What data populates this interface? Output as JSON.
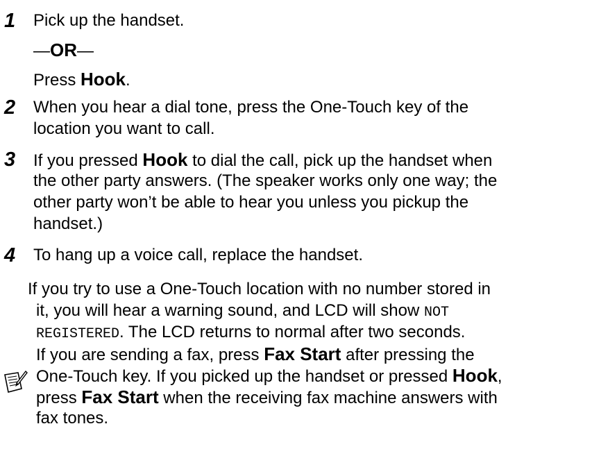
{
  "steps": [
    {
      "number": "1",
      "lines": [
        {
          "text": "Pick up the handset."
        },
        {
          "dash_left": "—",
          "bold": "OR",
          "dash_right": "—"
        },
        {
          "prefix": "Press ",
          "bold": "Hook",
          "suffix": "."
        }
      ]
    },
    {
      "number": "2",
      "lines": [
        "When you hear a dial tone, press the One-Touch key of the",
        "location you want to call."
      ]
    },
    {
      "number": "3",
      "first_line": {
        "prefix": "If you pressed ",
        "bold": "Hook",
        "suffix": " to dial the call, pick up the handset when"
      },
      "lines": [
        "the other party answers. (The speaker works only one way; the",
        "other party won’t be able to hear you unless you pickup the",
        "handset.)"
      ]
    },
    {
      "number": "4",
      "lines": [
        "To hang up a voice call, replace the handset."
      ]
    }
  ],
  "note": {
    "icon": "note-pencil-icon",
    "line1": "If you try to use a One-Touch location with no number stored in",
    "line2_prefix": "it, you will hear a warning sound, and LCD will show ",
    "line2_mono": "NOT",
    "line3_mono": "REGISTERED",
    "line3_suffix": ". The LCD returns to normal after two seconds.",
    "line4_prefix": "If you are sending a fax, press ",
    "line4_bold": "Fax Start",
    "line4_suffix": " after pressing the",
    "line5_prefix": "One-Touch key. If you picked up the handset or pressed ",
    "line5_bold": "Hook",
    "line5_suffix": ",",
    "line6_prefix": "press ",
    "line6_bold": "Fax Start",
    "line6_suffix": " when the receiving fax machine answers with",
    "line7": "fax tones."
  }
}
